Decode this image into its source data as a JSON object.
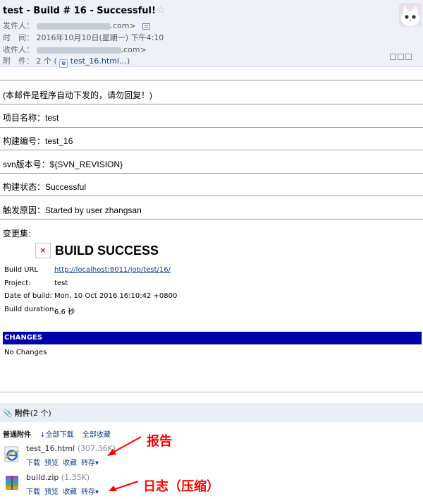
{
  "email": {
    "subject": "test - Build # 16 - Successful!",
    "star": "☆",
    "from_label": "发件人：",
    "from_domain": ".com>",
    "time_label": "时　间：",
    "time_value": "2016年10月10日(星期一) 下午4:10",
    "to_label": "收件人：",
    "to_domain": ".com>",
    "attach_label": "附　件：",
    "attach_count": "2 个",
    "attach_paren_open": "(",
    "attach_file": "test_16.html…",
    "attach_paren_close": ")"
  },
  "body": {
    "auto_notice": "(本邮件是程序自动下发的，请勿回复！)",
    "project_name": "项目名称：test",
    "build_number": "构建编号：test_16",
    "svn_version": "svn版本号：${SVN_REVISION}",
    "build_status": "构建状态：Successful",
    "trigger_reason": "触发原因：Started by user zhangsan",
    "changeset": "变更集:"
  },
  "report": {
    "broken_image_glyph": "×",
    "title": "BUILD SUCCESS",
    "rows": [
      {
        "label": "Build URL",
        "value": "http://localhost:8011/job/test/16/"
      },
      {
        "label": "Project:",
        "value": "test"
      },
      {
        "label": "Date of build:",
        "value": "Mon, 10 Oct 2016 16:10:42 +0800"
      },
      {
        "label": "Build duration:",
        "value": "6.6 秒"
      }
    ],
    "changes_header": "CHANGES",
    "no_changes": "No Changes"
  },
  "attachments": {
    "section_title": "附件",
    "section_count": "(2 个)",
    "plain_label": "普通附件",
    "download_all": "↓全部下载",
    "favorite_all": "全部收藏",
    "files": [
      {
        "name": "test_16.html",
        "size": "(307.36K)",
        "icon": "ie-icon"
      },
      {
        "name": "build.zip",
        "size": "(1.35K)",
        "icon": "archive-icon"
      }
    ],
    "actions": {
      "download": "下载",
      "preview": "预览",
      "favorite": "收藏",
      "save": "转存▾"
    }
  },
  "annotations": {
    "report": "报告",
    "log": "日志（压缩）"
  },
  "colors": {
    "header_bg": "#eef2f8",
    "link": "#1a3f94",
    "changes_bar": "#0000aa",
    "annotation": "#ff0000"
  }
}
